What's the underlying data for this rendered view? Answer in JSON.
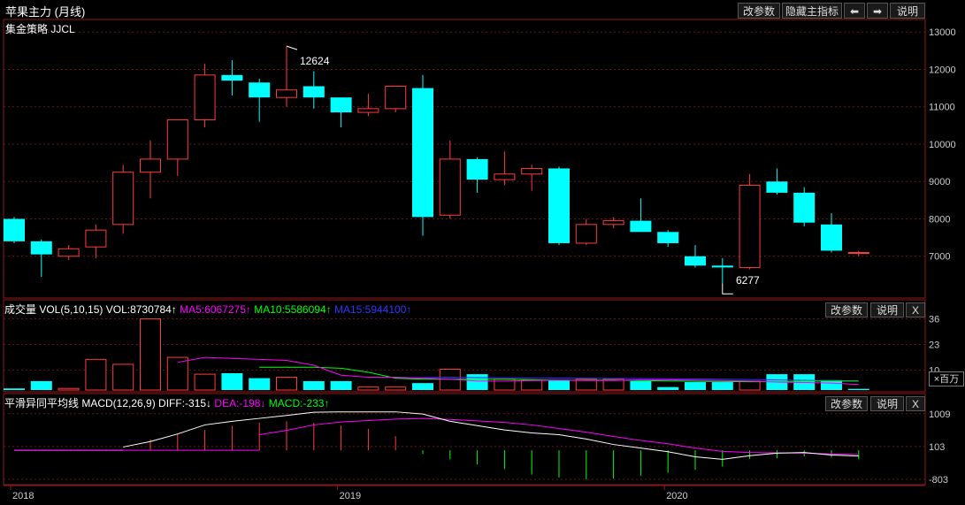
{
  "window": {
    "title": "苹果主力 (月线)",
    "buttons": {
      "params": "改参数",
      "hide": "隐藏主指标",
      "prev": "⬅",
      "next": "➡",
      "help": "说明"
    }
  },
  "main_panel": {
    "strategy_label": "集金策略 JJCL",
    "high_label": "12624",
    "low_label": "6277"
  },
  "vol_panel": {
    "label_prefix": "成交量 VOL(5,10,15)",
    "vol": "VOL:8730784↑",
    "ma5": "MA5:6067275↑",
    "ma10": "MA10:5586094↑",
    "ma15": "MA15:5944100↑",
    "params_btn": "改参数",
    "help_btn": "说明",
    "close_btn": "X",
    "unit_label": "×百万"
  },
  "macd_panel": {
    "label_prefix": "平滑异同平均线 MACD(12,26,9)",
    "diff": "DIFF:-315↓",
    "dea": "DEA:-198↓",
    "macd": "MACD:-233↑",
    "params_btn": "改参数",
    "help_btn": "说明",
    "close_btn": "X"
  },
  "colors": {
    "up": "#ff3b3b",
    "down": "#00ffff",
    "ma5": "#ff00ff",
    "ma10": "#00ff00",
    "ma15": "#3333ff",
    "diff": "#ffffff",
    "dea": "#ff00ff",
    "macd_pos": "#ff3b3b",
    "macd_neg": "#00ff00"
  },
  "chart_data": [
    {
      "type": "candlestick",
      "x_labels": [
        "2018",
        "2019",
        "2020"
      ],
      "ylim": [
        6000,
        13100
      ],
      "yticks": [
        7000,
        8000,
        9000,
        10000,
        11000,
        12000,
        13000
      ],
      "candles": [
        {
          "o": 8000,
          "h": 8050,
          "l": 7350,
          "c": 7400
        },
        {
          "o": 7400,
          "h": 7450,
          "l": 6450,
          "c": 7050
        },
        {
          "o": 7000,
          "h": 7300,
          "l": 6900,
          "c": 7200
        },
        {
          "o": 7250,
          "h": 7850,
          "l": 6950,
          "c": 7700
        },
        {
          "o": 7850,
          "h": 9450,
          "l": 7600,
          "c": 9250
        },
        {
          "o": 9250,
          "h": 10100,
          "l": 8550,
          "c": 9600
        },
        {
          "o": 9600,
          "h": 10650,
          "l": 9150,
          "c": 10650
        },
        {
          "o": 10650,
          "h": 12150,
          "l": 10450,
          "c": 11850
        },
        {
          "o": 11850,
          "h": 12250,
          "l": 11300,
          "c": 11700
        },
        {
          "o": 11650,
          "h": 11750,
          "l": 10600,
          "c": 11250
        },
        {
          "o": 11250,
          "h": 12624,
          "l": 11000,
          "c": 11450
        },
        {
          "o": 11550,
          "h": 11950,
          "l": 10950,
          "c": 11250
        },
        {
          "o": 11250,
          "h": 11250,
          "l": 10450,
          "c": 10850
        },
        {
          "o": 10850,
          "h": 11350,
          "l": 10750,
          "c": 10950
        },
        {
          "o": 10950,
          "h": 11550,
          "l": 10850,
          "c": 11550
        },
        {
          "o": 11500,
          "h": 11850,
          "l": 7550,
          "c": 8050
        },
        {
          "o": 8100,
          "h": 10100,
          "l": 8000,
          "c": 9600
        },
        {
          "o": 9600,
          "h": 9650,
          "l": 8700,
          "c": 9050
        },
        {
          "o": 9050,
          "h": 9800,
          "l": 8900,
          "c": 9200
        },
        {
          "o": 9200,
          "h": 9450,
          "l": 8750,
          "c": 9350
        },
        {
          "o": 9350,
          "h": 9400,
          "l": 7300,
          "c": 7350
        },
        {
          "o": 7350,
          "h": 8000,
          "l": 7300,
          "c": 7850
        },
        {
          "o": 7850,
          "h": 8050,
          "l": 7750,
          "c": 7950
        },
        {
          "o": 7950,
          "h": 8550,
          "l": 7650,
          "c": 7650
        },
        {
          "o": 7650,
          "h": 7700,
          "l": 7250,
          "c": 7350
        },
        {
          "o": 7000,
          "h": 7300,
          "l": 6700,
          "c": 6750
        },
        {
          "o": 6750,
          "h": 6950,
          "l": 6277,
          "c": 6700
        },
        {
          "o": 6700,
          "h": 9200,
          "l": 6650,
          "c": 8900
        },
        {
          "o": 9000,
          "h": 9350,
          "l": 8650,
          "c": 8700
        },
        {
          "o": 8700,
          "h": 8850,
          "l": 7800,
          "c": 7900
        },
        {
          "o": 7850,
          "h": 8150,
          "l": 7100,
          "c": 7150
        },
        {
          "o": 7100,
          "h": 7150,
          "l": 7000,
          "c": 7100
        }
      ]
    },
    {
      "type": "bar",
      "name": "VOL",
      "ylim": [
        0,
        38
      ],
      "yticks": [
        10,
        23,
        36
      ],
      "values": [
        0.8,
        4.5,
        0.8,
        15.5,
        13.0,
        36.0,
        16.5,
        8.0,
        8.5,
        6.0,
        6.5,
        4.5,
        4.5,
        1.5,
        1.5,
        3.5,
        10.5,
        8.0,
        5.5,
        5.0,
        5.0,
        5.5,
        5.5,
        4.5,
        1.5,
        4.0,
        4.0,
        4.5,
        8.0,
        8.0,
        5.0,
        0.6
      ],
      "up": [
        false,
        false,
        true,
        true,
        true,
        true,
        true,
        true,
        false,
        false,
        true,
        false,
        false,
        true,
        true,
        false,
        true,
        false,
        true,
        true,
        false,
        true,
        true,
        false,
        false,
        false,
        false,
        true,
        false,
        false,
        false,
        false
      ],
      "ma5": [
        null,
        null,
        null,
        null,
        null,
        null,
        14.0,
        16.5,
        16.0,
        15.5,
        15.0,
        12.5,
        7.5,
        6.5,
        6.5,
        6.0,
        5.5,
        4.5,
        4.5,
        4.8,
        5.0,
        4.8,
        4.8,
        5.2,
        5.2,
        5.0,
        4.8,
        4.5,
        4.0,
        3.8,
        3.5,
        2.8
      ],
      "ma10": [
        null,
        null,
        null,
        null,
        null,
        null,
        null,
        null,
        null,
        11.5,
        11.5,
        11.5,
        11.0,
        9.0,
        6.0,
        5.5,
        5.5,
        5.5,
        5.5,
        5.2,
        5.0,
        5.0,
        5.0,
        4.8,
        4.6,
        4.4,
        4.3,
        4.2,
        4.2,
        4.5,
        4.5,
        4.5
      ],
      "ma15": [
        null,
        null,
        null,
        null,
        null,
        null,
        null,
        null,
        null,
        null,
        null,
        null,
        null,
        null,
        6.0,
        6.2,
        6.5,
        6.3,
        6.2,
        6.0,
        6.0,
        5.9,
        5.8,
        5.8,
        5.7,
        5.6,
        5.5,
        5.3,
        5.1,
        4.9,
        4.7,
        4.6
      ]
    },
    {
      "type": "macd",
      "ylim": [
        -900,
        1150
      ],
      "yticks": [
        1009,
        103,
        -803
      ],
      "diff": [
        null,
        null,
        null,
        null,
        90,
        240,
        450,
        700,
        800,
        880,
        960,
        1050,
        1060,
        1060,
        1060,
        1000,
        800,
        680,
        560,
        480,
        430,
        310,
        160,
        60,
        -40,
        -180,
        -250,
        -150,
        -80,
        -60,
        -130,
        -160
      ],
      "dea": [
        null,
        null,
        null,
        null,
        null,
        null,
        null,
        null,
        null,
        430,
        550,
        700,
        780,
        820,
        860,
        880,
        850,
        810,
        770,
        700,
        600,
        500,
        380,
        270,
        180,
        60,
        -30,
        -60,
        -70,
        -80,
        -100,
        -120
      ],
      "macd": [
        0,
        0,
        0,
        0,
        0,
        300,
        450,
        560,
        670,
        760,
        800,
        760,
        680,
        590,
        390,
        -100,
        -250,
        -390,
        -520,
        -670,
        -750,
        -800,
        -780,
        -700,
        -620,
        -540,
        -450,
        -240,
        -220,
        -170,
        -200,
        -250
      ]
    }
  ]
}
